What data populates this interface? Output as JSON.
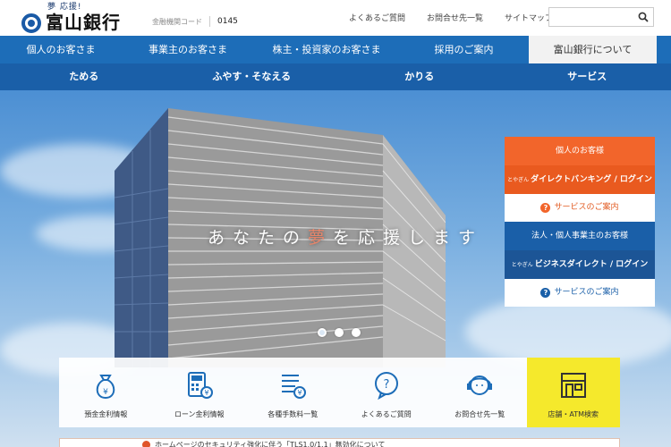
{
  "header": {
    "logo_tagline": "夢 応援!",
    "logo_name": "富山銀行",
    "bank_code_label": "金融機関コード",
    "bank_code_value": "0145",
    "util_links": [
      "よくあるご質問",
      "お問合せ先一覧",
      "サイトマップ"
    ],
    "search": {
      "placeholder": ""
    }
  },
  "nav_primary": [
    {
      "label": "個人のお客さま",
      "active": false
    },
    {
      "label": "事業主のお客さま",
      "active": false
    },
    {
      "label": "株主・投資家のお客さま",
      "active": false
    },
    {
      "label": "採用のご案内",
      "active": false
    },
    {
      "label": "富山銀行について",
      "active": true
    }
  ],
  "nav_secondary": [
    "ためる",
    "ふやす・そなえる",
    "かりる",
    "サービス"
  ],
  "hero": {
    "slogan_pre": "あなたの",
    "slogan_accent": "夢",
    "slogan_post": "を応援します",
    "slide_count": 3,
    "active_slide": 1
  },
  "side_panel": {
    "personal": {
      "heading": "個人のお客様",
      "prefix": "とやぎん",
      "service": "ダイレクトバンキング / ログイン",
      "guide": "サービスのご案内"
    },
    "business": {
      "heading": "法人・個人事業主のお客様",
      "prefix": "とやぎん",
      "service": "ビジネスダイレクト / ログイン",
      "guide": "サービスのご案内"
    }
  },
  "tiles": [
    {
      "label": "預金金利情報",
      "icon": "money-bag-yen-icon"
    },
    {
      "label": "ローン金利情報",
      "icon": "calculator-yen-icon"
    },
    {
      "label": "各種手数料一覧",
      "icon": "list-yen-icon"
    },
    {
      "label": "よくあるご質問",
      "icon": "question-bubble-icon"
    },
    {
      "label": "お問合せ先一覧",
      "icon": "headset-operator-icon"
    },
    {
      "label": "店舗・ATM検索",
      "icon": "atm-store-icon",
      "highlight": true
    }
  ],
  "notice": {
    "text": "ホームページのセキュリティ強化に伴う「TLS1.0/1.1」無効化について"
  },
  "colors": {
    "primary_blue": "#1d6db8",
    "dark_blue": "#1a5fa8",
    "orange": "#f2652b",
    "highlight_yellow": "#f5e92c"
  }
}
